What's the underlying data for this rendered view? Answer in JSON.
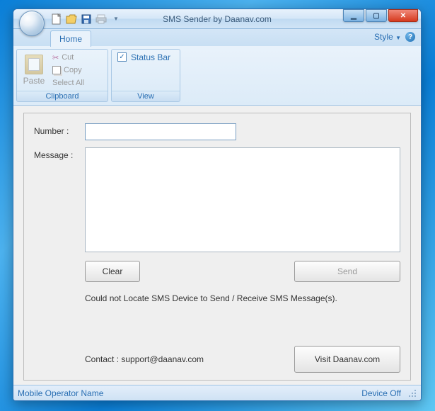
{
  "window": {
    "title": "SMS Sender by Daanav.com"
  },
  "ribbon": {
    "tab_home": "Home",
    "style_label": "Style",
    "clipboard": {
      "paste": "Paste",
      "cut": "Cut",
      "copy": "Copy",
      "select_all": "Select All",
      "group_label": "Clipboard"
    },
    "view": {
      "status_bar": "Status Bar",
      "group_label": "View",
      "status_bar_checked": true
    }
  },
  "form": {
    "number_label": "Number :",
    "number_value": "",
    "message_label": "Message :",
    "message_value": "",
    "clear": "Clear",
    "send": "Send",
    "status_text": "Could not Locate SMS Device to Send / Receive SMS Message(s).",
    "visit": "Visit Daanav.com",
    "contact": "Contact : support@daanav.com"
  },
  "statusbar": {
    "left": "Mobile Operator Name",
    "right": "Device Off"
  }
}
